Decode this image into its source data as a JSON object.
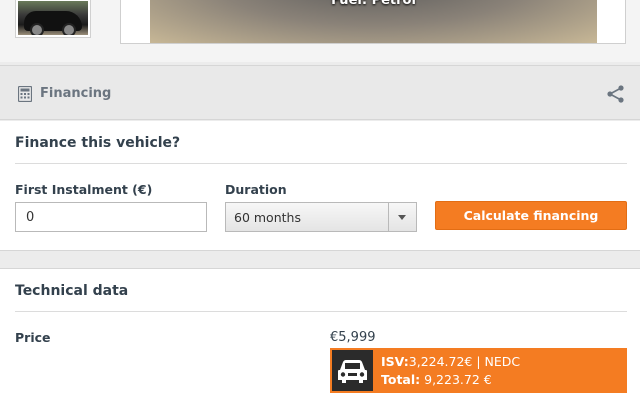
{
  "gallery": {
    "photo_overlay": "Fuel: Petrol",
    "thumb_icon": "car-thumbnail",
    "photo_icon": "car-photo"
  },
  "financing_header": {
    "title": "Financing",
    "icon": "calculator-icon",
    "share_icon": "share-icon"
  },
  "finance_form": {
    "heading": "Finance this vehicle?",
    "first_instalment_label": "First Instalment (€)",
    "first_instalment_value": "0",
    "duration_label": "Duration",
    "duration_value": "60 months",
    "calculate_label": "Calculate financing"
  },
  "technical_data": {
    "heading": "Technical data",
    "price_label": "Price",
    "price_value": "€5,999",
    "isv_label": "ISV:",
    "isv_value": "3,224.72€ | NEDC",
    "total_label": "Total:",
    "total_value": " 9,223.72 €",
    "isv_icon": "car-front-icon"
  },
  "colors": {
    "accent": "#f47c22",
    "heading": "#33414d",
    "background": "#ececec"
  }
}
